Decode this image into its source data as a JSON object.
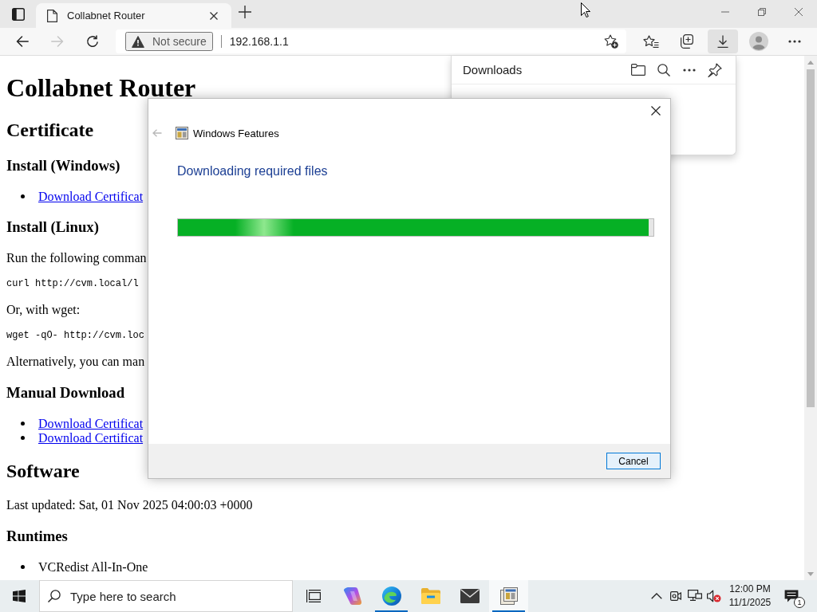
{
  "browser": {
    "tabs": [
      {
        "title": "Collabnet Router",
        "selected": true
      }
    ],
    "nav_buttons": [
      {
        "kind": "back",
        "disabled": false
      },
      {
        "kind": "forward",
        "disabled": true
      },
      {
        "kind": "refresh",
        "disabled": false
      }
    ],
    "address_bar": {
      "security_label": "Not secure",
      "url": "192.168.1.1"
    },
    "toolbar_buttons": [
      {
        "kind": "favorites",
        "selected": false
      },
      {
        "kind": "collections",
        "selected": false
      },
      {
        "kind": "downloads",
        "selected": true
      },
      {
        "kind": "profile",
        "selected": false
      },
      {
        "kind": "more",
        "selected": false
      }
    ]
  },
  "page": {
    "blocks": [
      {
        "kind": "h1",
        "text": "Collabnet Router"
      },
      {
        "kind": "h2",
        "text": "Certificate"
      },
      {
        "kind": "h3",
        "text": "Install (Windows)"
      },
      {
        "kind": "list",
        "items": [
          {
            "text": "Download Certificat",
            "link": true
          }
        ]
      },
      {
        "kind": "h3",
        "text": "Install (Linux)"
      },
      {
        "kind": "paragraph",
        "text": "Run the following comman"
      },
      {
        "kind": "code",
        "text": "curl http://cvm.local/l"
      },
      {
        "kind": "paragraph",
        "text": "Or, with wget:"
      },
      {
        "kind": "code",
        "text": "wget -qO- http://cvm.loc"
      },
      {
        "kind": "paragraph",
        "text": "Alternatively, you can man"
      },
      {
        "kind": "h3",
        "text": "Manual Download"
      },
      {
        "kind": "list",
        "items": [
          {
            "text": "Download Certificat",
            "link": true
          },
          {
            "text": "Download Certificat",
            "link": true
          }
        ]
      },
      {
        "kind": "h2",
        "text": "Software"
      },
      {
        "kind": "paragraph",
        "text": "Last updated: Sat, 01 Nov 2025 04:00:03 +0000"
      },
      {
        "kind": "h3",
        "text": "Runtimes"
      },
      {
        "kind": "list",
        "items": [
          {
            "text": "VCRedist All-In-One",
            "link": false
          }
        ]
      }
    ]
  },
  "downloads_panel": {
    "title": "Downloads",
    "actions": [
      {
        "kind": "folder"
      },
      {
        "kind": "search"
      },
      {
        "kind": "more"
      },
      {
        "kind": "pin"
      }
    ]
  },
  "dialog": {
    "back_button": {
      "disabled": true
    },
    "title": "Windows Features",
    "heading": "Downloading required files",
    "progress": {
      "level": 0.99
    },
    "buttons": [
      {
        "kind": "cancel",
        "label": "Cancel",
        "focused": true
      }
    ]
  },
  "taskbar": {
    "search": {
      "placeholder": "Type here to search"
    },
    "apps": [
      {
        "kind": "task_view",
        "running": false,
        "selected": false
      },
      {
        "kind": "copilot",
        "running": false,
        "selected": false
      },
      {
        "kind": "edge",
        "running": true,
        "selected": false
      },
      {
        "kind": "explorer",
        "running": false,
        "selected": false
      },
      {
        "kind": "mail",
        "running": false,
        "selected": false
      },
      {
        "kind": "features",
        "running": true,
        "selected": true
      }
    ],
    "tray": [
      {
        "kind": "chevron"
      },
      {
        "kind": "device"
      },
      {
        "kind": "network"
      },
      {
        "kind": "volume",
        "muted": true
      }
    ],
    "clock": {
      "time": "12:00 PM",
      "date": "11/1/2025"
    },
    "notifications": {
      "count": "1"
    }
  }
}
